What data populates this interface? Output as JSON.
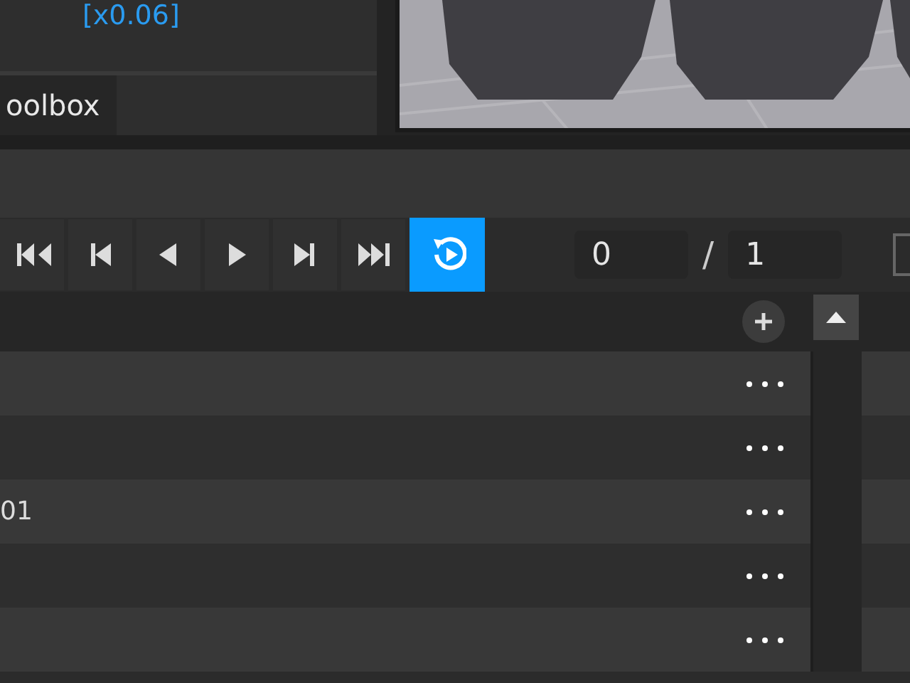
{
  "properties_panel": {
    "value_text": "[x0.06]"
  },
  "dock_tabs": [
    {
      "label": "oolbox",
      "selected": true
    }
  ],
  "transport": {
    "loop": {
      "on": true
    }
  },
  "frame": {
    "current": "0",
    "separator": "/",
    "total": "1"
  },
  "tracks": [
    {
      "kind": "track"
    },
    {
      "kind": "track"
    },
    {
      "kind": "track",
      "name": "01"
    },
    {
      "kind": "track"
    },
    {
      "kind": "track"
    }
  ]
}
